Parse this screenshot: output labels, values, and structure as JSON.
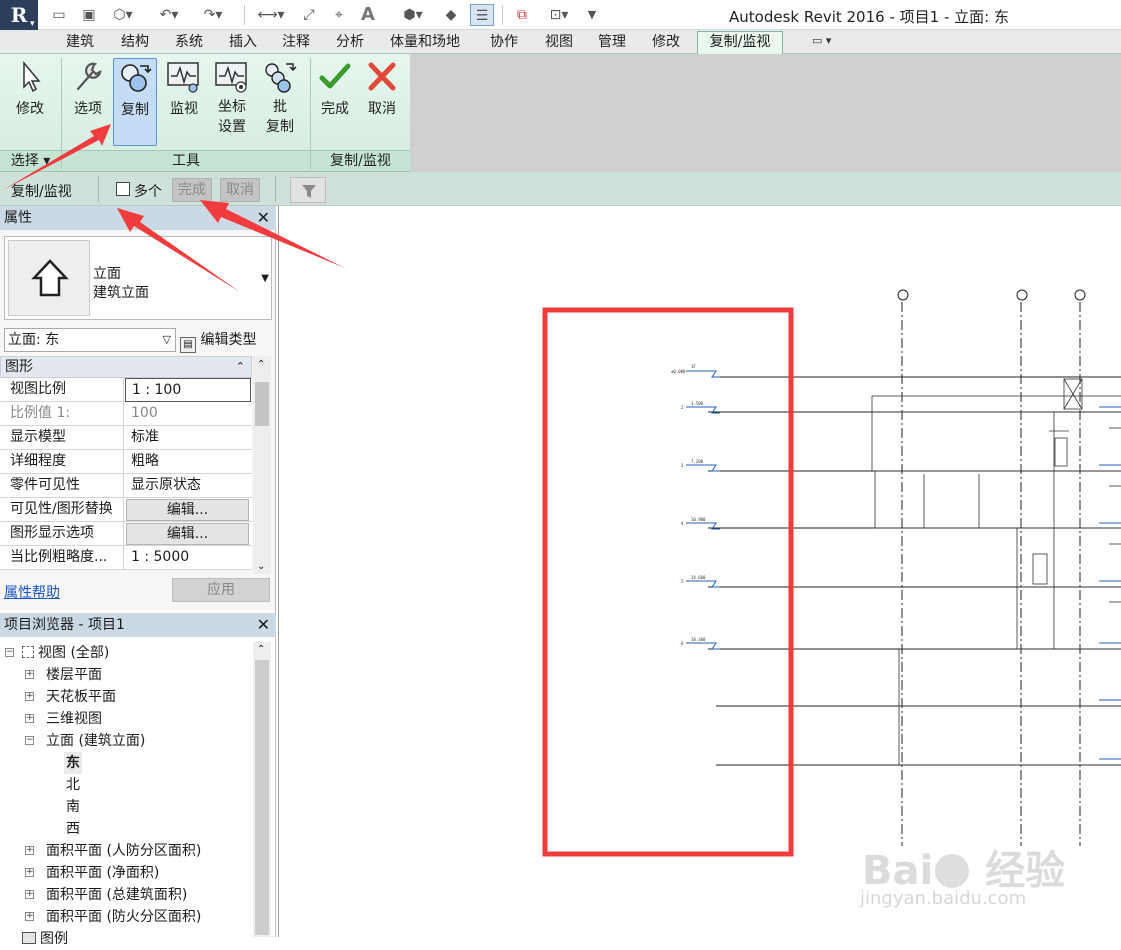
{
  "window": {
    "title": "Autodesk Revit 2016 -      项目1 - 立面: 东"
  },
  "app": {
    "logo": "R"
  },
  "quick_access": [
    "open-icon",
    "save-icon",
    "sync-icon",
    "undo-icon",
    "redo-icon",
    "measure-icon",
    "aligned-dimension-icon",
    "tag-icon",
    "text-icon",
    "3d-view-icon",
    "section-icon",
    "thin-lines-icon",
    "close-windows-icon",
    "switch-windows-icon",
    "customize-icon"
  ],
  "ribbon": {
    "tabs": [
      "建筑",
      "结构",
      "系统",
      "插入",
      "注释",
      "分析",
      "体量和场地",
      "协作",
      "视图",
      "管理",
      "修改"
    ],
    "active_tab": "复制/监视",
    "buttons": {
      "modify": "修改",
      "options": "选项",
      "copy": "复制",
      "monitor": "监视",
      "coord_line1": "坐标",
      "coord_line2": "设置",
      "batch_line1": "批",
      "batch_line2": "复制",
      "finish": "完成",
      "cancel": "取消"
    },
    "panels": {
      "select": "选择 ▾",
      "tools": "工具",
      "copy_monitor": "复制/监视"
    }
  },
  "options_bar": {
    "context": "复制/监视",
    "multiple_label": "多个",
    "multiple_checked": false,
    "finish": "完成",
    "cancel": "取消"
  },
  "properties": {
    "title": "属性",
    "type_name_1": "立面",
    "type_name_2": "建筑立面",
    "instance": "立面: 东",
    "edit_type": "编辑类型",
    "group": "图形",
    "rows": [
      {
        "name": "视图比例",
        "value": "1 : 100"
      },
      {
        "name": "比例值 1:",
        "value": "100"
      },
      {
        "name": "显示模型",
        "value": "标准"
      },
      {
        "name": "详细程度",
        "value": "粗略"
      },
      {
        "name": "零件可见性",
        "value": "显示原状态"
      },
      {
        "name": "可见性/图形替换",
        "value": "编辑..."
      },
      {
        "name": "图形显示选项",
        "value": "编辑..."
      },
      {
        "name": "当比例粗略度...",
        "value": "1 : 5000"
      }
    ],
    "help": "属性帮助",
    "apply": "应用"
  },
  "browser": {
    "title": "项目浏览器 - 项目1",
    "nodes": {
      "views_all": "视图 (全部)",
      "floor_plans": "楼层平面",
      "ceiling_plans": "天花板平面",
      "views_3d": "三维视图",
      "elevations": "立面 (建筑立面)",
      "east": "东",
      "north": "北",
      "south": "南",
      "west": "西",
      "area_civil": "面积平面 (人防分区面积)",
      "area_net": "面积平面 (净面积)",
      "area_gross": "面积平面 (总建筑面积)",
      "area_fire": "面积平面 (防火分区面积)",
      "legends": "图例"
    }
  },
  "watermark": {
    "text": "Bai  经验",
    "url": "jingyan.baidu.com"
  },
  "colors": {
    "annotation_red": "#f03c3c",
    "ribbon_green": "#e6f6ee",
    "selection_blue": "#c4dcf5",
    "level_blue": "#1f5fbf"
  }
}
